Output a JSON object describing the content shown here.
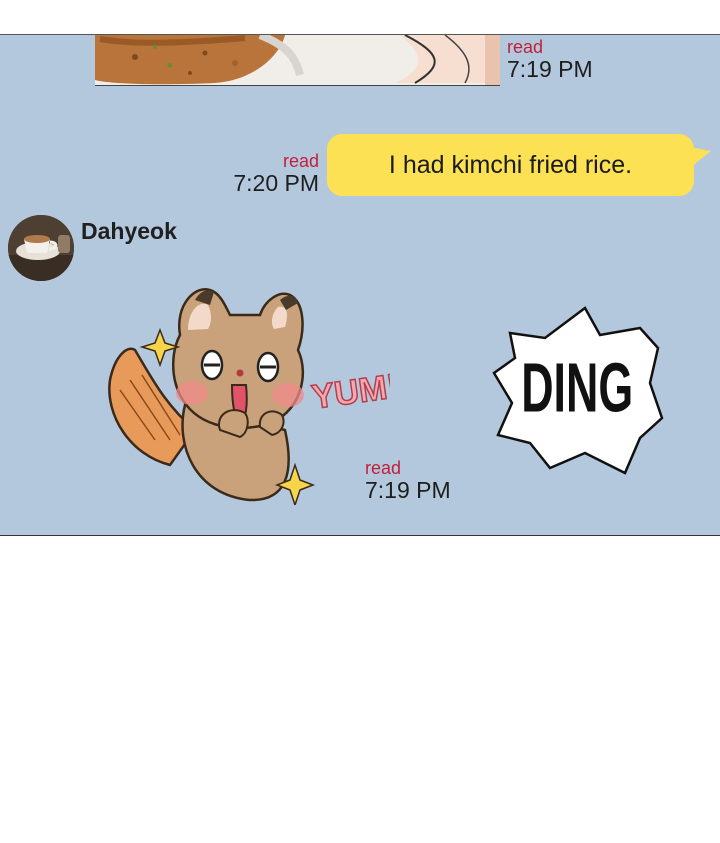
{
  "colors": {
    "chat_background": "#b4c8dd",
    "bubble_yellow": "#fce154",
    "read_red": "#c0213a"
  },
  "messages": [
    {
      "type": "image",
      "read_label": "read",
      "time": "7:19 PM"
    },
    {
      "type": "text",
      "text": "I had kimchi fried rice.",
      "read_label": "read",
      "time": "7:20 PM"
    },
    {
      "type": "sticker",
      "sender": "Dahyeok",
      "sticker_text": "YUM!",
      "read_label": "read",
      "time": "7:19 PM"
    }
  ],
  "overlay_text": "DING",
  "icons": {
    "avatar": "coffee-cup-avatar-icon",
    "sticker": "fox-sticker-icon",
    "burst": "ding-burst-icon"
  }
}
